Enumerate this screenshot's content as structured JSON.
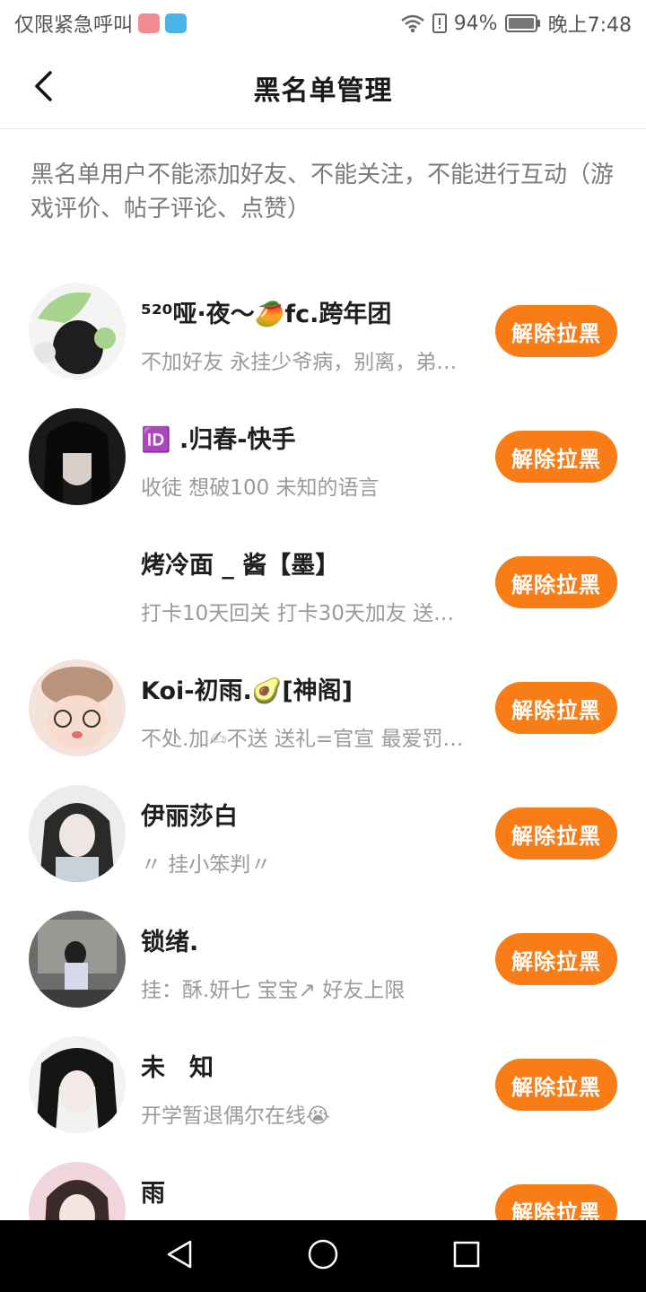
{
  "status_bar": {
    "carrier": "仅限紧急呼叫",
    "battery": "94%",
    "time": "晚上7:48"
  },
  "header": {
    "title": "黑名单管理"
  },
  "description": "黑名单用户不能添加好友、不能关注，不能进行互动（游戏评价、帖子评论、点赞）",
  "button_label": "解除拉黑",
  "users": [
    {
      "name": "⁵²⁰哑·夜～🥭fc.跨年团",
      "signature": "不加好友 永挂少爷病，别离，弟…"
    },
    {
      "name": "🆔 .归春-快手",
      "signature": "收徒 想破100 未知的语言"
    },
    {
      "name": "烤冷面 _ 酱【墨】",
      "signature": "打卡10天回关 打卡30天加友 送一…"
    },
    {
      "name": "Koi-初雨.🥑[神阁]",
      "signature": "不处.加✍不送 送礼=官宣 最爱罚…"
    },
    {
      "name": "伊丽莎白",
      "signature": "〃 挂小笨判〃"
    },
    {
      "name": "锁绪.",
      "signature": "挂：酥.妍七 宝宝↗ 好友上限"
    },
    {
      "name": "未　知",
      "signature": "开学暂退偶尔在线😭"
    },
    {
      "name": "雨",
      "signature": ""
    }
  ],
  "colors": {
    "accent": "#f97d16",
    "nav_bar": "#000000"
  }
}
